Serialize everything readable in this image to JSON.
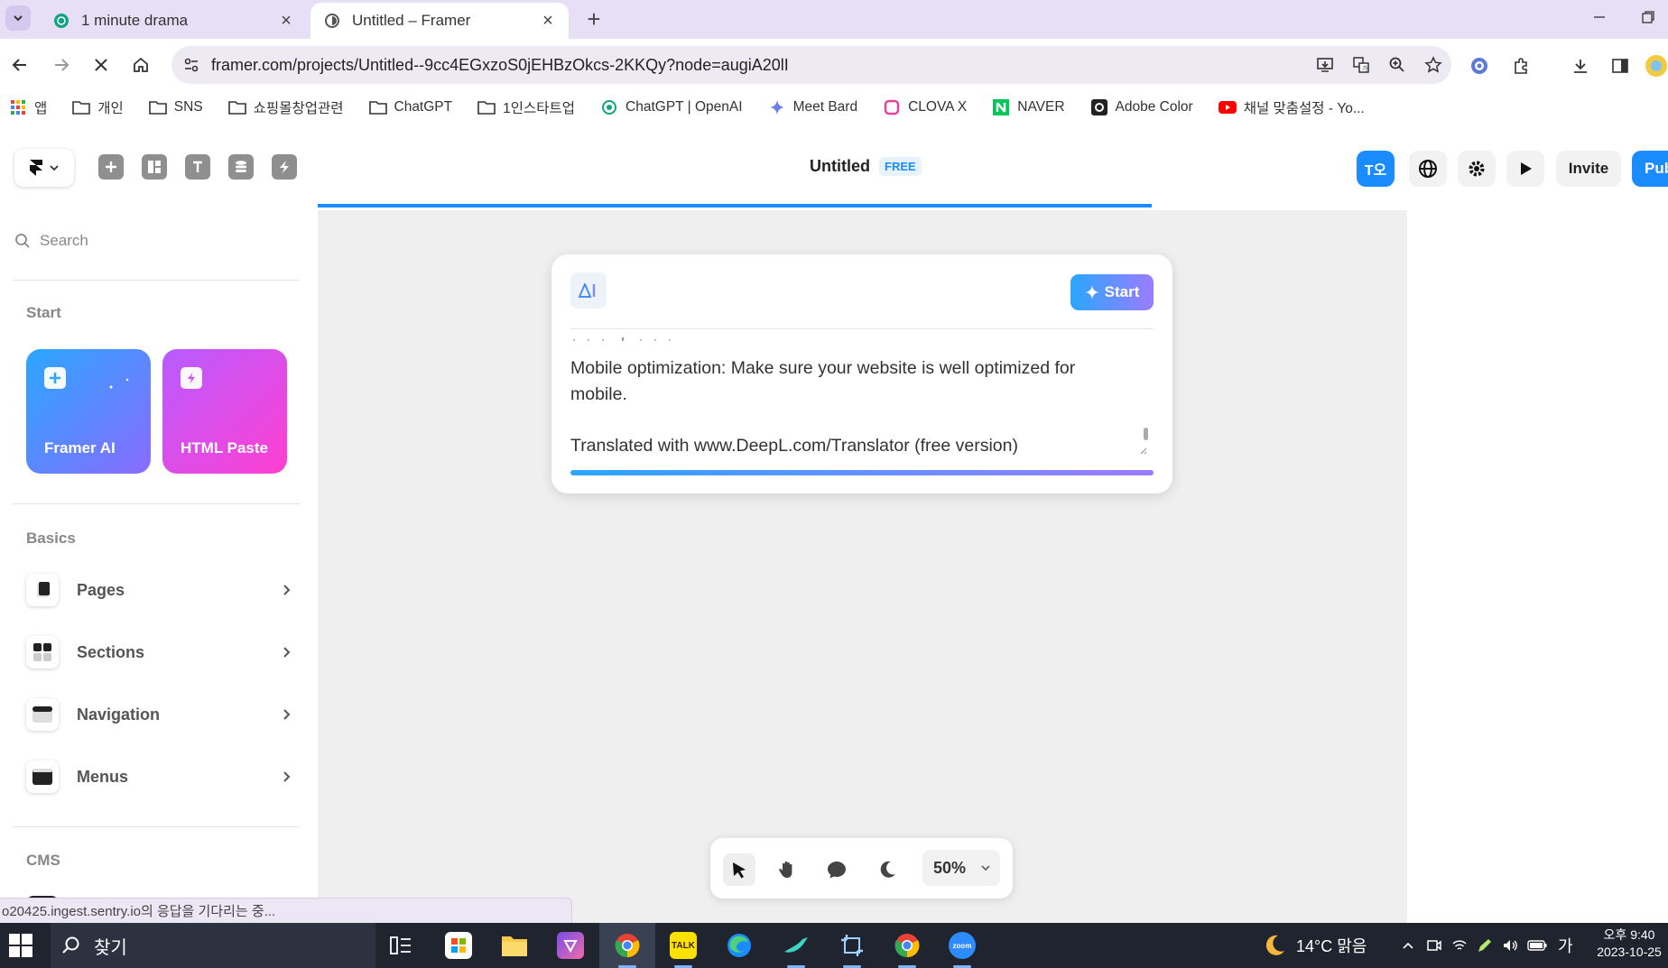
{
  "browser": {
    "tabs": [
      {
        "title": "1 minute drama",
        "active": false
      },
      {
        "title": "Untitled – Framer",
        "active": true
      }
    ],
    "url": "framer.com/projects/Untitled--9cc4EGxzoS0jEHBzOkcs-2KKQy?node=augiA20lI",
    "bookmarks": [
      {
        "label": "앱",
        "icon": "apps-grid-icon"
      },
      {
        "label": "개인",
        "icon": "folder-icon"
      },
      {
        "label": "SNS",
        "icon": "folder-icon"
      },
      {
        "label": "쇼핑몰창업관련",
        "icon": "folder-icon"
      },
      {
        "label": "ChatGPT",
        "icon": "folder-icon"
      },
      {
        "label": "1인스타트업",
        "icon": "folder-icon"
      },
      {
        "label": "ChatGPT | OpenAI",
        "icon": "openai-icon"
      },
      {
        "label": "Meet Bard",
        "icon": "bard-icon"
      },
      {
        "label": "CLOVA X",
        "icon": "clova-icon"
      },
      {
        "label": "NAVER",
        "icon": "naver-icon"
      },
      {
        "label": "Adobe Color",
        "icon": "adobe-color-icon"
      },
      {
        "label": "채널 맞춤설정 - Yo...",
        "icon": "youtube-icon"
      }
    ],
    "status_text": "o20425.ingest.sentry.io의 응답을 기다리는 중..."
  },
  "framer": {
    "project_title": "Untitled",
    "plan_badge": "FREE",
    "avatar_initials": "T오",
    "invite_label": "Invite",
    "publish_label": "Pub",
    "sidebar": {
      "search_placeholder": "Search",
      "start_heading": "Start",
      "start_cards": [
        {
          "label": "Framer AI"
        },
        {
          "label": "HTML Paste"
        }
      ],
      "basics_heading": "Basics",
      "basics_items": [
        {
          "label": "Pages"
        },
        {
          "label": "Sections"
        },
        {
          "label": "Navigation"
        },
        {
          "label": "Menus"
        }
      ],
      "cms_heading": "CMS"
    },
    "ai_prompt": {
      "badge": "AI",
      "start_label": "Start",
      "text_lines": [
        "Mobile optimization: Make sure your website is well optimized for mobile.",
        "Translated with www.DeepL.com/Translator (free version)"
      ]
    },
    "bottom_toolbar": {
      "zoom": "50%"
    }
  },
  "taskbar": {
    "search_label": "찾기",
    "weather": "14°C 맑음",
    "ime": "가",
    "time": "오후 9:40",
    "date": "2023-10-25"
  },
  "colors": {
    "accent": "#1a8cff",
    "framer_ai_gradient": [
      "#2aa7ff",
      "#8a6bff"
    ],
    "html_paste_gradient": [
      "#b75cff",
      "#ff3fd1"
    ],
    "tabstrip": "#e7dff6",
    "taskbar": "#20242f"
  }
}
